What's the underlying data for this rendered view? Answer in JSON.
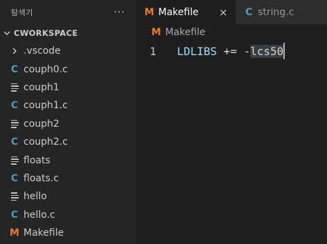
{
  "colors": {
    "sidebar_bg": "#252526",
    "editor_bg": "#1e1e1e",
    "c_file_icon": "#519aba",
    "makefile_icon": "#e37933",
    "makefile_variable": "#9cdcfe",
    "operator": "#d4d4d4"
  },
  "sidebar": {
    "title": "탐색기",
    "more_glyph": "···",
    "workspace": "CWORKSPACE",
    "items": [
      {
        "label": ".vscode",
        "type": "folder",
        "icon": "chevron-right-icon"
      },
      {
        "label": "couph0.c",
        "type": "c",
        "icon": "c-file-icon",
        "glyph": "C"
      },
      {
        "label": "couph1",
        "type": "binary",
        "icon": "text-file-icon"
      },
      {
        "label": "couph1.c",
        "type": "c",
        "icon": "c-file-icon",
        "glyph": "C"
      },
      {
        "label": "couph2",
        "type": "binary",
        "icon": "text-file-icon"
      },
      {
        "label": "couph2.c",
        "type": "c",
        "icon": "c-file-icon",
        "glyph": "C"
      },
      {
        "label": "floats",
        "type": "binary",
        "icon": "text-file-icon"
      },
      {
        "label": "floats.c",
        "type": "c",
        "icon": "c-file-icon",
        "glyph": "C"
      },
      {
        "label": "hello",
        "type": "binary",
        "icon": "text-file-icon"
      },
      {
        "label": "hello.c",
        "type": "c",
        "icon": "c-file-icon",
        "glyph": "C"
      },
      {
        "label": "Makefile",
        "type": "makefile",
        "icon": "makefile-icon",
        "glyph": "M"
      }
    ]
  },
  "tabs": [
    {
      "label": "Makefile",
      "glyph": "M",
      "icon": "makefile-icon",
      "active": true,
      "close": "×"
    },
    {
      "label": "string.c",
      "glyph": "C",
      "icon": "c-file-icon",
      "active": false
    }
  ],
  "breadcrumb": {
    "glyph": "M",
    "label": "Makefile"
  },
  "editor": {
    "line_number": "1",
    "code": {
      "variable": "LDLIBS",
      "operator": " += ",
      "value_plain": "-",
      "value_highlight": "lcs50"
    }
  }
}
